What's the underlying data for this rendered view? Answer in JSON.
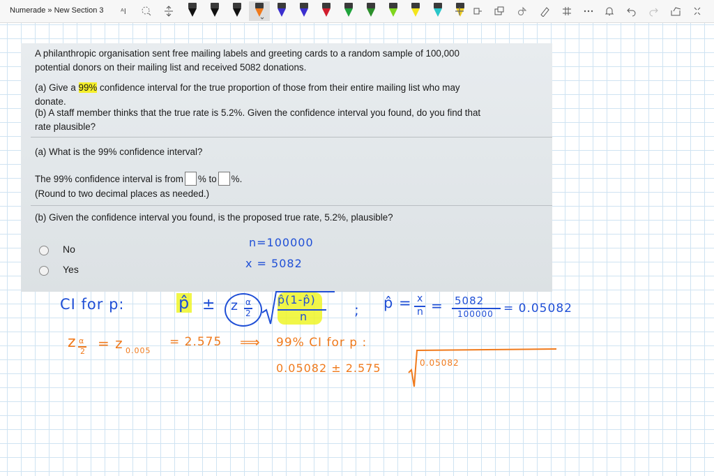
{
  "toolbar": {
    "breadcrumb": "Numerade » New Section 3",
    "icons": [
      "lasso-select-icon",
      "add-space-icon",
      "insert-space-icon",
      "add-pen-icon",
      "ruler-icon",
      "math-icon",
      "more-icon",
      "bell-icon",
      "undo-icon",
      "redo-icon",
      "share-icon",
      "fullscreen-icon"
    ],
    "pen_colors": [
      "#111111",
      "#111111",
      "#111111",
      "#f07a1c",
      "#3b2fcf",
      "#3b2fcf",
      "#d11d2d",
      "#1fa33b",
      "#2b8f2b",
      "#7fd61e",
      "#f3e51c",
      "#29c6c9",
      "#f5d326"
    ],
    "selected_pen": 3
  },
  "question": {
    "intro_line1": "A philanthropic organisation sent free mailing labels and greeting cards to a random sample of 100,000",
    "intro_line2": "potential donors on their mailing list and received 5082 donations.",
    "part_a_prefix": "(a) Give a ",
    "part_a_highlight": "99%",
    "part_a_suffix": " confidence interval for the true proportion of those from their entire mailing list who may",
    "part_a_line2": "donate.",
    "part_b_line1": "(b) A staff member thinks that the true rate is 5.2%. Given the confidence interval you found, do you find that",
    "part_b_line2": "rate plausible?",
    "sub_a_heading": "(a) What is the 99% confidence interval?",
    "ci_prefix": "The 99% confidence interval is from",
    "ci_mid": "% to",
    "ci_suffix": "%.",
    "round_note": "(Round to two decimal places as needed.)",
    "sub_b_heading": "(b) Given the confidence interval you found, is the proposed true rate, 5.2%, plausible?",
    "option_no": "No",
    "option_yes": "Yes"
  },
  "handwriting": {
    "n_given": "n=100000",
    "x_given": "x = 5082",
    "ci_for_p": "CI for p:",
    "p_hat": "p̂",
    "plus_minus": "±",
    "z_alpha_half": "z",
    "alpha_frac_num": "α",
    "alpha_frac_den": "2",
    "sqrt_num": "p̂(1-p̂)",
    "sqrt_den": "n",
    "semicolon": ";",
    "p_hat_eq": "p̂ =",
    "x_over_n_num": "x",
    "x_over_n_den": "n",
    "eq": "=",
    "frac_num": "5082",
    "frac_den": "100000",
    "result": "= 0.05082",
    "z_line_left": "z",
    "z_line_mid": "= z",
    "z_sub": "0.005",
    "z_value": "= 2.575",
    "arrow": "⟹",
    "ci99_label": "99% CI for p :",
    "final_expr": "0.05082 ± 2.575",
    "final_sqrt_content": "0.05082"
  },
  "colors": {
    "grid": "#cfe3f2",
    "blue_ink": "#1f4fd6",
    "orange_ink": "#f07a1c",
    "highlighter": "#eef528"
  }
}
